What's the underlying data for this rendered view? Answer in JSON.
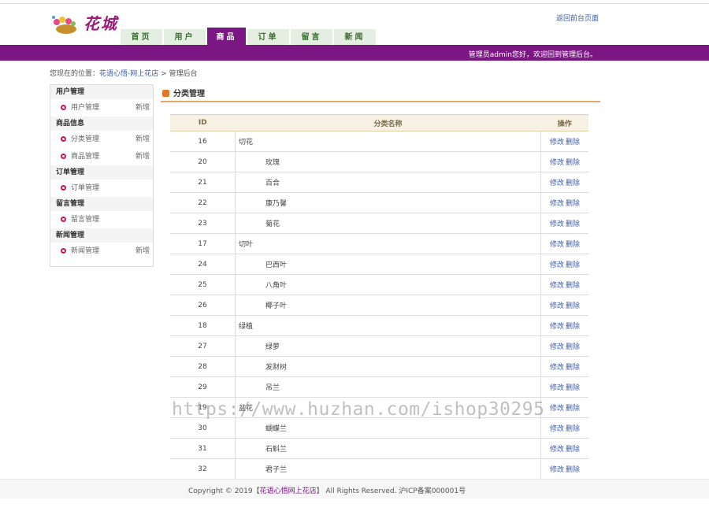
{
  "logo": {
    "brand": "花城",
    "icon": "flower-basket-icon"
  },
  "header": {
    "return_link": "返回前台页面"
  },
  "nav": {
    "tabs": [
      "首页",
      "用户",
      "商品",
      "订单",
      "留言",
      "新闻"
    ],
    "active_index": 2
  },
  "welcome_bar": {
    "text": "管理员admin您好，欢迎回到管理后台。"
  },
  "breadcrumb": {
    "prefix": "您现在的位置：",
    "site": "花语心悟-网上花店",
    "sep": " > ",
    "current": "管理后台"
  },
  "sidebar": {
    "groups": [
      {
        "title": "用户管理",
        "items": [
          {
            "label": "用户管理",
            "add": "新增"
          }
        ]
      },
      {
        "title": "商品信息",
        "items": [
          {
            "label": "分类管理",
            "add": "新增"
          },
          {
            "label": "商品管理",
            "add": "新增"
          }
        ]
      },
      {
        "title": "订单管理",
        "items": [
          {
            "label": "订单管理",
            "add": ""
          }
        ]
      },
      {
        "title": "留言管理",
        "items": [
          {
            "label": "留言管理",
            "add": ""
          }
        ]
      },
      {
        "title": "新闻管理",
        "items": [
          {
            "label": "新闻管理",
            "add": "新增"
          }
        ]
      }
    ]
  },
  "section": {
    "title": "分类管理"
  },
  "table": {
    "headers": [
      "ID",
      "分类名称",
      "操作"
    ],
    "edit_label": "修改",
    "delete_label": "删除",
    "rows": [
      {
        "id": "16",
        "name": "切花",
        "child": false
      },
      {
        "id": "20",
        "name": "玫瑰",
        "child": true
      },
      {
        "id": "21",
        "name": "百合",
        "child": true
      },
      {
        "id": "22",
        "name": "康乃馨",
        "child": true
      },
      {
        "id": "23",
        "name": "菊花",
        "child": true
      },
      {
        "id": "17",
        "name": "切叶",
        "child": false
      },
      {
        "id": "24",
        "name": "巴西叶",
        "child": true
      },
      {
        "id": "25",
        "name": "八角叶",
        "child": true
      },
      {
        "id": "26",
        "name": "椰子叶",
        "child": true
      },
      {
        "id": "18",
        "name": "绿植",
        "child": false
      },
      {
        "id": "27",
        "name": "绿萝",
        "child": true
      },
      {
        "id": "28",
        "name": "发财树",
        "child": true
      },
      {
        "id": "29",
        "name": "吊兰",
        "child": true
      },
      {
        "id": "19",
        "name": "盆花",
        "child": false
      },
      {
        "id": "30",
        "name": "蝴蝶兰",
        "child": true
      },
      {
        "id": "31",
        "name": "石斛兰",
        "child": true
      },
      {
        "id": "32",
        "name": "君子兰",
        "child": true
      }
    ]
  },
  "watermark": {
    "text": "https://www.huzhan.com/ishop30295"
  },
  "footer": {
    "prefix": "Copyright © 2019【",
    "site": "花语心悟网上花店",
    "suffix": "】 All Rights Reserved. 沪ICP备案000001号"
  },
  "colors": {
    "brand_purple": "#7a1782",
    "nav_tab_bg": "#e4efe1",
    "link_blue": "#3b5aa5",
    "accent_orange": "#e2792a"
  }
}
